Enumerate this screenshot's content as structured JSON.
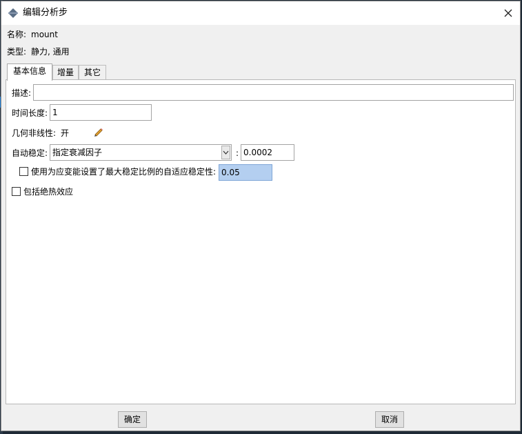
{
  "window": {
    "title": "编辑分析步",
    "close_icon": "close-icon"
  },
  "header": {
    "name_label": "名称:",
    "name_value": "mount",
    "type_label": "类型:",
    "type_value": "静力, 通用"
  },
  "tabs": [
    {
      "label": "基本信息",
      "active": true
    },
    {
      "label": "增量",
      "active": false
    },
    {
      "label": "其它",
      "active": false
    }
  ],
  "basic": {
    "description_label": "描述:",
    "description_value": "",
    "time_label": "时间长度:",
    "time_value": "1",
    "nlgeom_label": "几何非线性:",
    "nlgeom_value": "开",
    "stabilize_label": "自动稳定:",
    "stabilize_option": "指定衰减因子",
    "colon": ":",
    "damping_value": "0.0002",
    "adaptive_label": "使用为应变能设置了最大稳定比例的自适应稳定性:",
    "adaptive_checked": false,
    "adaptive_value": "0.05",
    "adiabatic_label": "包括绝热效应",
    "adiabatic_checked": false
  },
  "footer": {
    "ok_label": "确定",
    "cancel_label": "取消"
  },
  "colors": {
    "highlight": "#b4cff0",
    "pencil": "#e0a030"
  }
}
